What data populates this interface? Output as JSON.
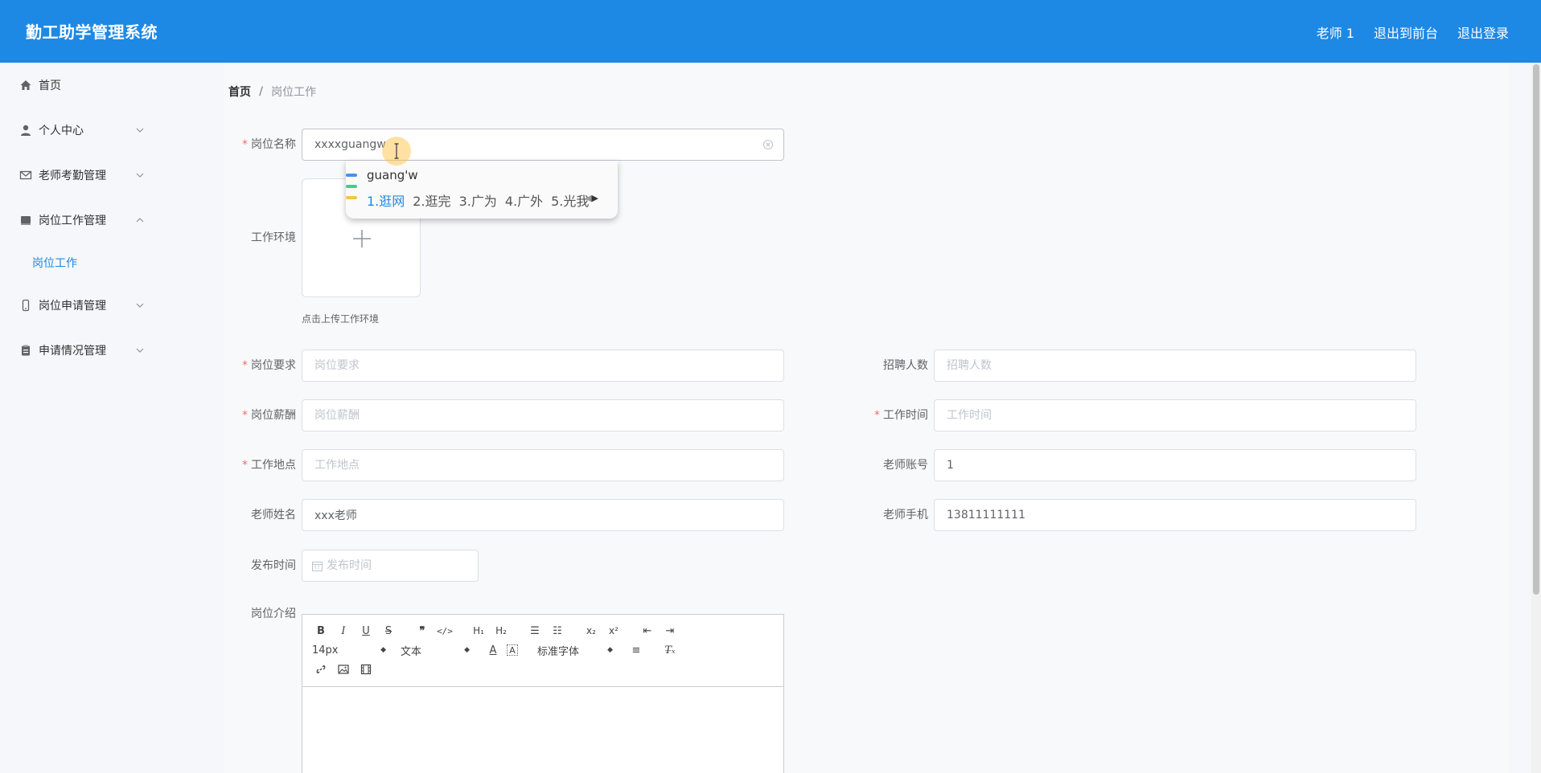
{
  "header": {
    "title": "勤工助学管理系统",
    "user": "老师 1",
    "to_front": "退出到前台",
    "logout": "退出登录"
  },
  "sidebar": {
    "items": [
      {
        "label": "首页",
        "icon": "home-icon"
      },
      {
        "label": "个人中心",
        "icon": "user-icon",
        "expanded": false
      },
      {
        "label": "老师考勤管理",
        "icon": "mail-icon",
        "expanded": false
      },
      {
        "label": "岗位工作管理",
        "icon": "folder-icon",
        "expanded": true
      },
      {
        "label": "岗位申请管理",
        "icon": "mobile-icon",
        "expanded": false
      },
      {
        "label": "申请情况管理",
        "icon": "clipboard-icon",
        "expanded": false
      }
    ],
    "submenu": {
      "label": "岗位工作"
    }
  },
  "breadcrumb": {
    "home": "首页",
    "separator": "/",
    "current": "岗位工作"
  },
  "form": {
    "job_name": {
      "label": "岗位名称",
      "value": "xxxxguangw"
    },
    "environment": {
      "label": "工作环境",
      "tip": "点击上传工作环境"
    },
    "requirement": {
      "label": "岗位要求",
      "placeholder": "岗位要求"
    },
    "headcount": {
      "label": "招聘人数",
      "placeholder": "招聘人数"
    },
    "salary": {
      "label": "岗位薪酬",
      "placeholder": "岗位薪酬"
    },
    "work_time": {
      "label": "工作时间",
      "placeholder": "工作时间"
    },
    "location": {
      "label": "工作地点",
      "placeholder": "工作地点"
    },
    "teacher_account": {
      "label": "老师账号",
      "value": "1"
    },
    "teacher_name": {
      "label": "老师姓名",
      "value": "xxx老师"
    },
    "teacher_phone": {
      "label": "老师手机",
      "value": "13811111111"
    },
    "publish_time": {
      "label": "发布时间",
      "placeholder": "发布时间"
    },
    "intro": {
      "label": "岗位介绍"
    }
  },
  "editor": {
    "font_size": "14px",
    "text_type": "文本",
    "font_family": "标准字体"
  },
  "ime": {
    "composition": "guang'w",
    "candidates": [
      "1.逛网",
      "2.逛完",
      "3.广为",
      "4.广外",
      "5.光我"
    ],
    "bar_colors": [
      "#4a90e2",
      "#3ecf8e",
      "#f5c542"
    ]
  },
  "colors": {
    "primary": "#1e88e5",
    "required": "#f56c6c"
  }
}
